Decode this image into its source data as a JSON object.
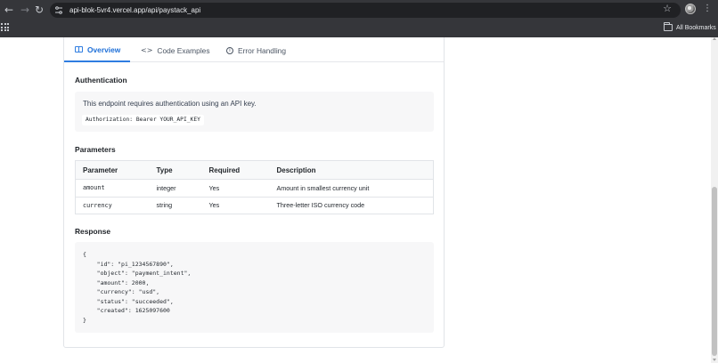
{
  "browser": {
    "url": "api-blok-5vr4.vercel.app/api/paystack_api",
    "bookmarks_label": "All Bookmarks",
    "icons": [
      "back-icon",
      "forward-icon",
      "reload-icon",
      "site-info-icon",
      "star-icon",
      "profile-avatar",
      "menu-icon",
      "apps-icon",
      "folder-icon"
    ]
  },
  "tabs": [
    {
      "label": "Overview",
      "icon": "book-icon",
      "active": true
    },
    {
      "label": "Code Examples",
      "icon": "code-icon",
      "active": false
    },
    {
      "label": "Error Handling",
      "icon": "info-icon",
      "active": false
    }
  ],
  "authentication": {
    "title": "Authentication",
    "description": "This endpoint requires authentication using an API key.",
    "header_example": "Authorization: Bearer YOUR_API_KEY"
  },
  "parameters": {
    "title": "Parameters",
    "columns": [
      "Parameter",
      "Type",
      "Required",
      "Description"
    ],
    "rows": [
      [
        "amount",
        "integer",
        "Yes",
        "Amount in smallest currency unit"
      ],
      [
        "currency",
        "string",
        "Yes",
        "Three-letter ISO currency code"
      ]
    ]
  },
  "response": {
    "title": "Response",
    "body": "{\n    \"id\": \"pi_1234567890\",\n    \"object\": \"payment_intent\",\n    \"amount\": 2000,\n    \"currency\": \"usd\",\n    \"status\": \"succeeded\",\n    \"created\": 1625097600\n}"
  },
  "colors": {
    "accent": "#2f7de1",
    "chrome_bg": "#35363a",
    "box_bg": "#f7f7f8"
  }
}
